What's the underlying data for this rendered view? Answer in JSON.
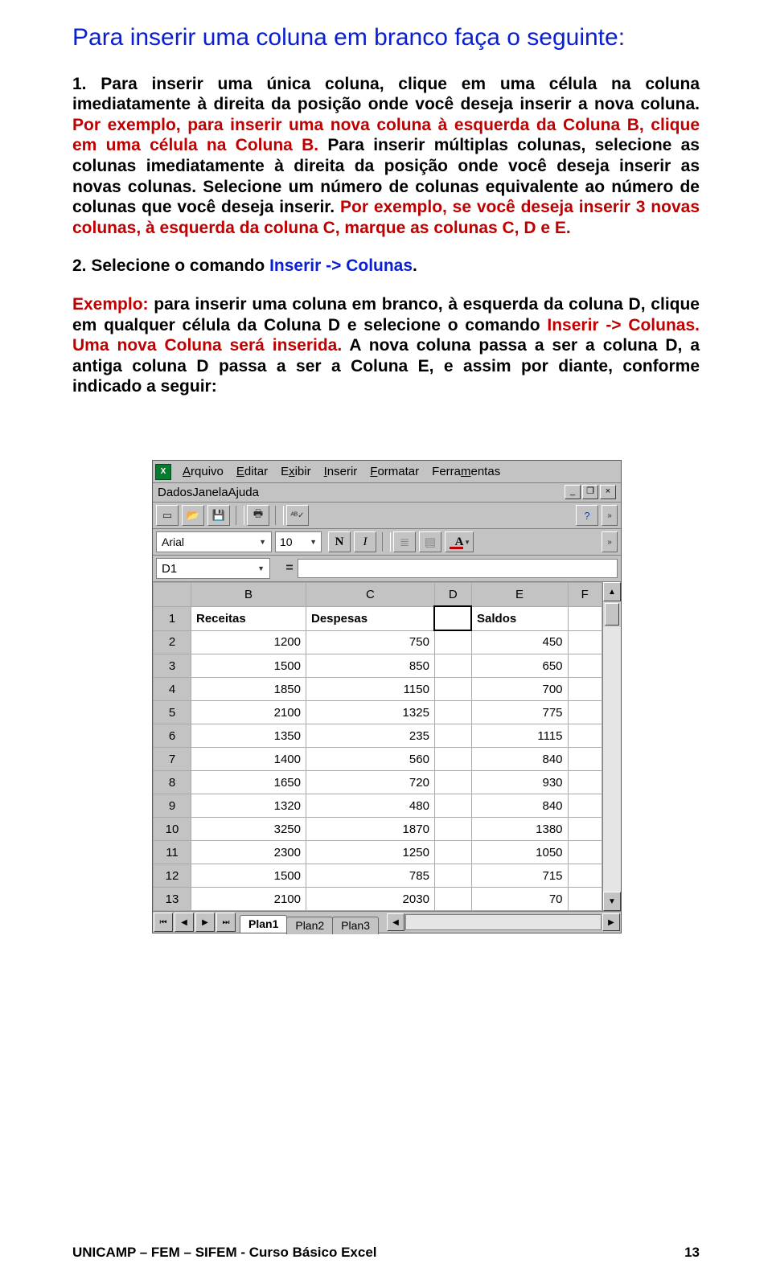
{
  "doc": {
    "title": "Para inserir uma coluna em branco faça o seguinte:",
    "p1_a": "1. Para inserir uma única coluna, clique em uma célula na coluna imediatamente à direita da posição onde você deseja inserir a nova coluna.",
    "p1_b": "Por exemplo, para inserir uma nova coluna à esquerda da Coluna B, clique em uma célula na Coluna B.",
    "p1_c": "Para inserir múltiplas colunas, selecione as colunas imediatamente à direita da posição onde você deseja inserir as novas colunas. Selecione um número de colunas equivalente ao número de colunas que você deseja inserir.",
    "p1_d": "Por exemplo, se você deseja inserir 3 novas colunas, à esquerda da coluna C, marque as colunas C, D e E.",
    "p2_a": "2. Selecione o comando ",
    "p2_b": "Inserir -> Colunas",
    "p2_c": ".",
    "p3_a": "Exemplo: ",
    "p3_b": "para inserir uma coluna em branco, à esquerda da coluna D, clique em qualquer célula da Coluna D e selecione o comando ",
    "p3_c": "Inserir -> Colunas",
    "p3_d": ". Uma nova Coluna será inserida. ",
    "p3_e": "A nova coluna passa a ser a coluna D, a antiga coluna D passa a ser a Coluna E, e assim por diante, conforme indicado a seguir:"
  },
  "excel": {
    "menus_row1": [
      {
        "accel": "A",
        "rest": "rquivo"
      },
      {
        "accel": "E",
        "rest": "ditar"
      },
      {
        "accel": "E",
        "rest": "xibir",
        "pre": ""
      },
      {
        "accel": "I",
        "rest": "nserir"
      },
      {
        "accel": "F",
        "rest": "ormatar"
      },
      {
        "accel": "F",
        "rest": "erra",
        "post": "mentas",
        "accel2": "m"
      }
    ],
    "menus_row2": [
      {
        "accel": "D",
        "rest": "ados"
      },
      {
        "accel": "J",
        "rest": "anela"
      },
      {
        "accel": "A",
        "rest": "juda",
        "pre": "",
        "accelpos": 2
      }
    ],
    "font_name": "Arial",
    "font_size": "10",
    "bold_label": "N",
    "italic_label": "I",
    "color_label": "A",
    "namebox": "D1",
    "fx_eq": "=",
    "colheads": [
      "B",
      "C",
      "D",
      "E",
      "F"
    ],
    "rows": [
      {
        "n": "1",
        "cells": [
          "Receitas",
          "Despesas",
          "",
          "Saldos",
          ""
        ],
        "type": "header"
      },
      {
        "n": "2",
        "cells": [
          "1200",
          "750",
          "",
          "450",
          ""
        ]
      },
      {
        "n": "3",
        "cells": [
          "1500",
          "850",
          "",
          "650",
          ""
        ]
      },
      {
        "n": "4",
        "cells": [
          "1850",
          "1150",
          "",
          "700",
          ""
        ]
      },
      {
        "n": "5",
        "cells": [
          "2100",
          "1325",
          "",
          "775",
          ""
        ]
      },
      {
        "n": "6",
        "cells": [
          "1350",
          "235",
          "",
          "1115",
          ""
        ]
      },
      {
        "n": "7",
        "cells": [
          "1400",
          "560",
          "",
          "840",
          ""
        ]
      },
      {
        "n": "8",
        "cells": [
          "1650",
          "720",
          "",
          "930",
          ""
        ]
      },
      {
        "n": "9",
        "cells": [
          "1320",
          "480",
          "",
          "840",
          ""
        ]
      },
      {
        "n": "10",
        "cells": [
          "3250",
          "1870",
          "",
          "1380",
          ""
        ]
      },
      {
        "n": "11",
        "cells": [
          "2300",
          "1250",
          "",
          "1050",
          ""
        ]
      },
      {
        "n": "12",
        "cells": [
          "1500",
          "785",
          "",
          "715",
          ""
        ]
      },
      {
        "n": "13",
        "cells": [
          "2100",
          "2030",
          "",
          "70",
          ""
        ]
      }
    ],
    "tabs": [
      "Plan1",
      "Plan2",
      "Plan3"
    ],
    "active_tab": 0
  },
  "footer": {
    "left": "UNICAMP – FEM – SIFEM - Curso Básico Excel",
    "right": "13"
  }
}
